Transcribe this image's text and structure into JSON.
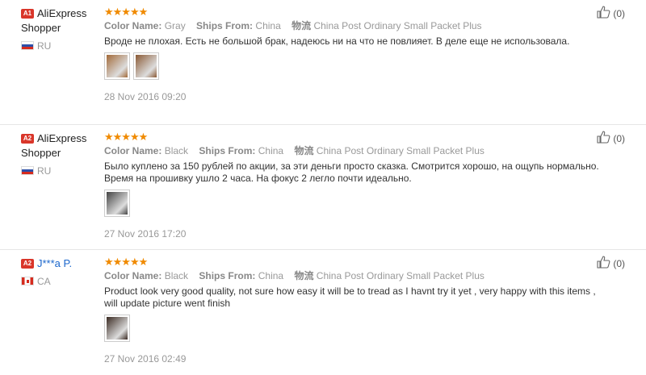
{
  "reviews": [
    {
      "badge": "A1",
      "user": "AliExpress Shopper",
      "user_link": false,
      "country": "RU",
      "flag": "ru",
      "stars": "★★★★★",
      "meta": [
        {
          "k": "Color Name:",
          "v": "Gray"
        },
        {
          "k": "Ships From:",
          "v": "China"
        },
        {
          "k": "物流",
          "v": "China Post Ordinary Small Packet Plus"
        }
      ],
      "text": "Вроде не плохая. Есть не большой брак, надеюсь ни на что не повлияет. В деле еще не использовала.",
      "thumbs": [
        "#a26a3a",
        "#8a5a35"
      ],
      "date": "28 Nov 2016 09:20",
      "likes": "(0)"
    },
    {
      "badge": "A2",
      "user": "AliExpress Shopper",
      "user_link": false,
      "country": "RU",
      "flag": "ru",
      "stars": "★★★★★",
      "meta": [
        {
          "k": "Color Name:",
          "v": "Black"
        },
        {
          "k": "Ships From:",
          "v": "China"
        },
        {
          "k": "物流",
          "v": "China Post Ordinary Small Packet Plus"
        }
      ],
      "text": "Было куплено за 150 рублей по акции, за эти деньги просто сказка. Смотрится хорошо, на ощупь нормально. Время на прошивку ушло 2 часа. На фокус 2 легло почти идеально.",
      "thumbs": [
        "#444444"
      ],
      "date": "27 Nov 2016 17:20",
      "likes": "(0)"
    },
    {
      "badge": "A2",
      "user": "J***a P.",
      "user_link": true,
      "country": "CA",
      "flag": "ca",
      "stars": "★★★★★",
      "meta": [
        {
          "k": "Color Name:",
          "v": "Black"
        },
        {
          "k": "Ships From:",
          "v": "China"
        },
        {
          "k": "物流",
          "v": "China Post Ordinary Small Packet Plus"
        }
      ],
      "text": "Product look very good quality, not sure how easy it will be to tread as I havnt try it yet , very happy with this items , will update picture went finish",
      "thumbs": [
        "#3a2a22"
      ],
      "date": "27 Nov 2016 02:49",
      "likes": "(0)"
    }
  ]
}
